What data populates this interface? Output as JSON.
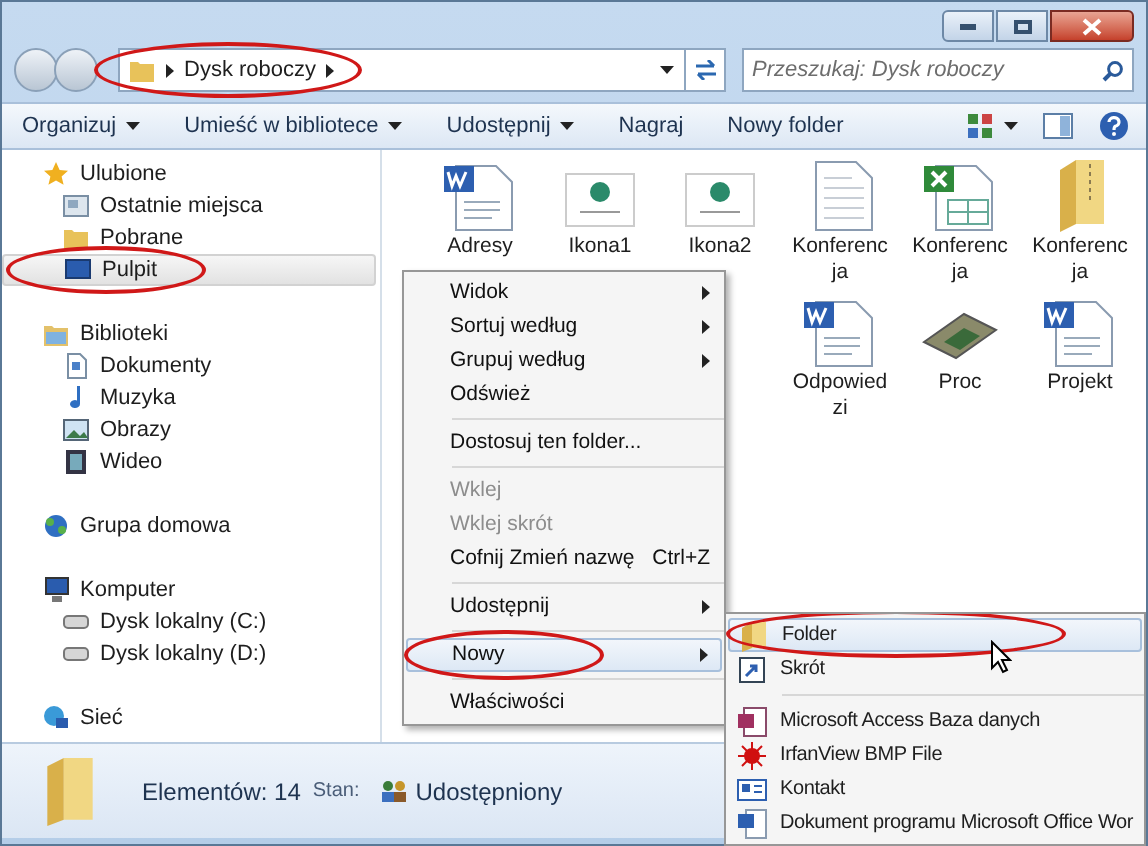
{
  "address": {
    "crumb": "Dysk roboczy",
    "circled": true
  },
  "search": {
    "placeholder": "Przeszukaj: Dysk roboczy"
  },
  "toolbar": [
    {
      "label": "Organizuj",
      "dropdown": true
    },
    {
      "label": "Umieść w bibliotece",
      "dropdown": true
    },
    {
      "label": "Udostępnij",
      "dropdown": true
    },
    {
      "label": "Nagraj",
      "dropdown": false
    },
    {
      "label": "Nowy folder",
      "dropdown": false
    }
  ],
  "sidebar": [
    {
      "label": "Ulubione",
      "kind": "star",
      "selected": false,
      "circled": false,
      "children": [
        {
          "label": "Ostatnie miejsca",
          "kind": "recent",
          "selected": false,
          "circled": false
        },
        {
          "label": "Pobrane",
          "kind": "folder",
          "selected": false,
          "circled": false
        },
        {
          "label": "Pulpit",
          "kind": "desktop",
          "selected": true,
          "circled": true
        }
      ]
    },
    {
      "label": "Biblioteki",
      "kind": "library",
      "selected": false,
      "circled": false,
      "children": [
        {
          "label": "Dokumenty",
          "kind": "doc",
          "selected": false,
          "circled": false
        },
        {
          "label": "Muzyka",
          "kind": "music",
          "selected": false,
          "circled": false
        },
        {
          "label": "Obrazy",
          "kind": "picture",
          "selected": false,
          "circled": false
        },
        {
          "label": "Wideo",
          "kind": "video",
          "selected": false,
          "circled": false
        }
      ]
    },
    {
      "label": "Grupa domowa",
      "kind": "homegroup",
      "selected": false,
      "circled": false
    },
    {
      "label": "Komputer",
      "kind": "computer",
      "selected": false,
      "circled": false,
      "children": [
        {
          "label": "Dysk lokalny (C:)",
          "kind": "drive",
          "selected": false,
          "circled": false
        },
        {
          "label": "Dysk lokalny (D:)",
          "kind": "drive",
          "selected": false,
          "circled": false
        }
      ]
    },
    {
      "label": "Sieć",
      "kind": "network",
      "selected": false,
      "circled": false
    }
  ],
  "files": [
    [
      {
        "name": "Adresy",
        "kind": "word"
      },
      {
        "name": "Ikona1",
        "kind": "thumb"
      },
      {
        "name": "Ikona2",
        "kind": "thumb"
      },
      {
        "name": "Konferencja",
        "kind": "text"
      },
      {
        "name": "Konferencja",
        "kind": "excel"
      },
      {
        "name": "Konferencja",
        "kind": "zip"
      }
    ],
    [
      {
        "name": "Odpowiedzi",
        "kind": "word"
      },
      {
        "name": "Proc",
        "kind": "chip"
      },
      {
        "name": "Projekt",
        "kind": "word"
      }
    ]
  ],
  "context_menu": [
    {
      "kind": "item",
      "label": "Widok",
      "submenu": true,
      "disabled": false,
      "selected": false,
      "circled": false
    },
    {
      "kind": "item",
      "label": "Sortuj według",
      "submenu": true,
      "disabled": false,
      "selected": false,
      "circled": false
    },
    {
      "kind": "item",
      "label": "Grupuj według",
      "submenu": true,
      "disabled": false,
      "selected": false,
      "circled": false
    },
    {
      "kind": "item",
      "label": "Odśwież",
      "submenu": false,
      "disabled": false,
      "selected": false,
      "circled": false
    },
    {
      "kind": "separator"
    },
    {
      "kind": "item",
      "label": "Dostosuj ten folder...",
      "submenu": false,
      "disabled": false,
      "selected": false,
      "circled": false
    },
    {
      "kind": "separator"
    },
    {
      "kind": "item",
      "label": "Wklej",
      "submenu": false,
      "disabled": true,
      "selected": false,
      "circled": false
    },
    {
      "kind": "item",
      "label": "Wklej skrót",
      "submenu": false,
      "disabled": true,
      "selected": false,
      "circled": false
    },
    {
      "kind": "item",
      "label": "Cofnij Zmień nazwę",
      "shortcut": "Ctrl+Z",
      "submenu": false,
      "disabled": false,
      "selected": false,
      "circled": false
    },
    {
      "kind": "separator"
    },
    {
      "kind": "item",
      "label": "Udostępnij",
      "submenu": true,
      "disabled": false,
      "selected": false,
      "circled": false
    },
    {
      "kind": "separator"
    },
    {
      "kind": "item",
      "label": "Nowy",
      "submenu": true,
      "disabled": false,
      "selected": true,
      "circled": true
    },
    {
      "kind": "separator"
    },
    {
      "kind": "item",
      "label": "Właściwości",
      "submenu": false,
      "disabled": false,
      "selected": false,
      "circled": false
    }
  ],
  "new_menu": [
    {
      "kind": "item",
      "label": "Folder",
      "selected": true,
      "circled": true
    },
    {
      "kind": "item",
      "label": "Skrót",
      "selected": false,
      "circled": false
    },
    {
      "kind": "separator"
    },
    {
      "kind": "item",
      "label": "Microsoft Access Baza danych",
      "selected": false,
      "circled": false
    },
    {
      "kind": "item",
      "label": "IrfanView BMP File",
      "selected": false,
      "circled": false
    },
    {
      "kind": "item",
      "label": "Kontakt",
      "selected": false,
      "circled": false
    },
    {
      "kind": "item",
      "label": "Dokument programu Microsoft Office Wor",
      "selected": false,
      "circled": false
    }
  ],
  "status_bar": {
    "count": "Elementów: 14",
    "state_label": "Stan:",
    "state": "Udostępniony"
  }
}
